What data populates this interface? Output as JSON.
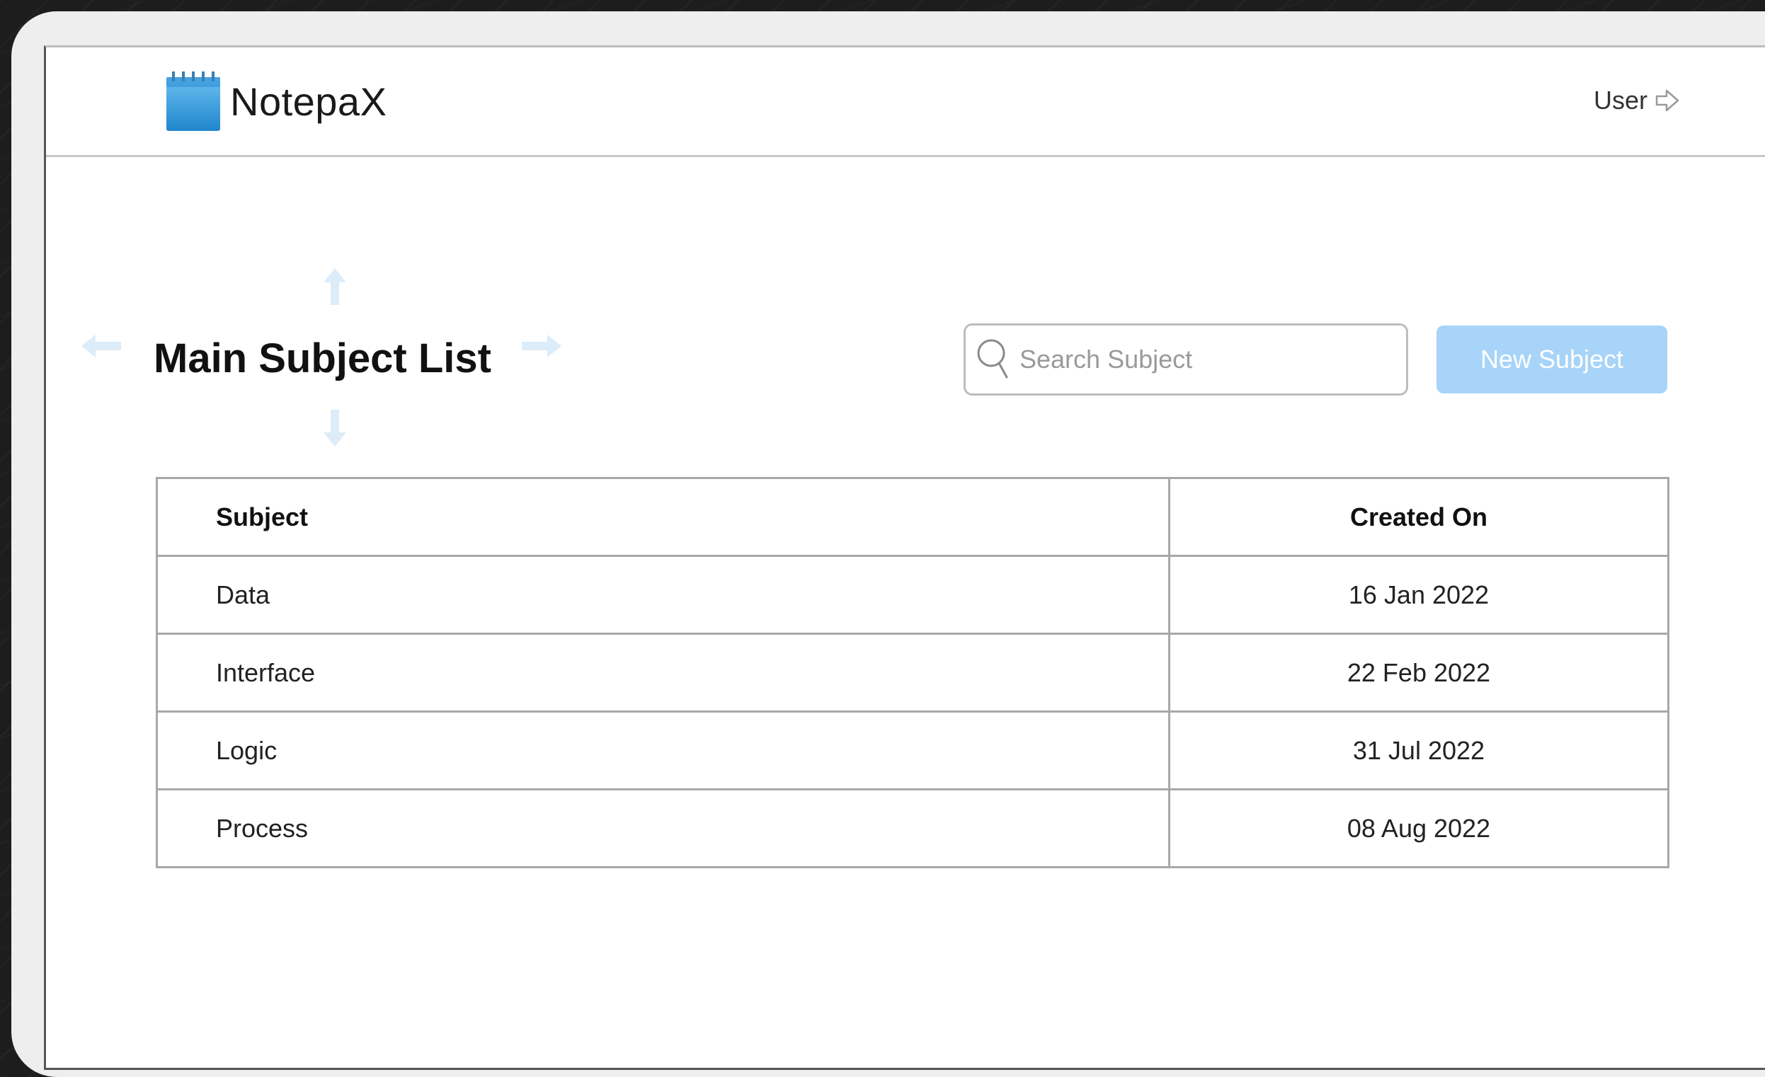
{
  "app": {
    "name": "NotepaX",
    "user_label": "User"
  },
  "page": {
    "title": "Main Subject List"
  },
  "search": {
    "placeholder": "Search Subject"
  },
  "actions": {
    "new_subject_label": "New Subject"
  },
  "table": {
    "headers": {
      "subject": "Subject",
      "created_on": "Created On"
    },
    "rows": [
      {
        "subject": "Data",
        "created_on": "16 Jan 2022"
      },
      {
        "subject": "Interface",
        "created_on": "22 Feb 2022"
      },
      {
        "subject": "Logic",
        "created_on": "31 Jul 2022"
      },
      {
        "subject": "Process",
        "created_on": "08 Aug 2022"
      }
    ]
  },
  "colors": {
    "primary_button": "#a7d4f8",
    "logo_blue": "#3a9ee0",
    "guide_arrow": "#dcecf8"
  },
  "icons": {
    "logo": "notepad-icon",
    "user": "logout-arrow-icon",
    "search": "search-icon",
    "guides": [
      "arrow-up-icon",
      "arrow-down-icon",
      "arrow-left-icon",
      "arrow-right-icon"
    ]
  }
}
